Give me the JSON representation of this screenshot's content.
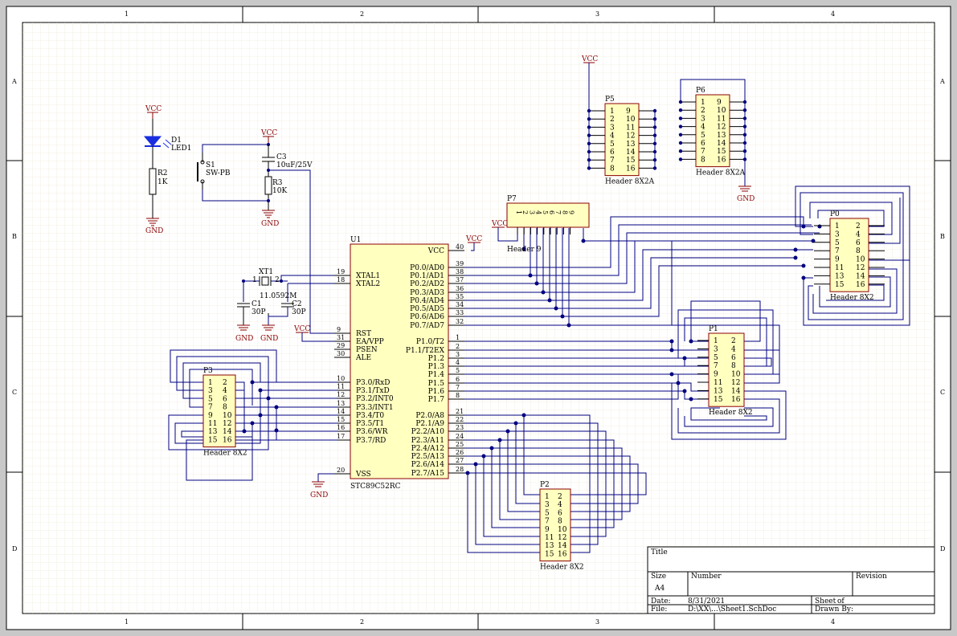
{
  "zone_cols": [
    "1",
    "2",
    "3",
    "4"
  ],
  "zone_rows": [
    "A",
    "B",
    "C",
    "D"
  ],
  "power": {
    "vcc": "VCC",
    "gnd": "GND"
  },
  "parts": {
    "d1": {
      "ref": "D1",
      "value": "LED1"
    },
    "r2": {
      "ref": "R2",
      "value": "1K"
    },
    "s1": {
      "ref": "S1",
      "value": "SW-PB"
    },
    "c3": {
      "ref": "C3",
      "value": "10uF/25V"
    },
    "r3": {
      "ref": "R3",
      "value": "10K"
    },
    "xt1": {
      "ref": "XT1",
      "value": "11.0592M",
      "pin1": "1",
      "pin2": "2"
    },
    "c1": {
      "ref": "C1",
      "value": "30P"
    },
    "c2": {
      "ref": "C2",
      "value": "30P"
    }
  },
  "u1": {
    "ref": "U1",
    "value": "STC89C52RC",
    "left_pins": [
      {
        "num": "19",
        "name": "XTAL1"
      },
      {
        "num": "18",
        "name": "XTAL2"
      },
      {
        "num": "9",
        "name": "RST"
      },
      {
        "num": "31",
        "name": "EA/VPP"
      },
      {
        "num": "29",
        "name": "PSEN"
      },
      {
        "num": "30",
        "name": "ALE"
      },
      {
        "num": "10",
        "name": "P3.0/RxD"
      },
      {
        "num": "11",
        "name": "P3.1/TxD"
      },
      {
        "num": "12",
        "name": "P3.2/INT0"
      },
      {
        "num": "13",
        "name": "P3.3/INT1"
      },
      {
        "num": "14",
        "name": "P3.4/T0"
      },
      {
        "num": "15",
        "name": "P3.5/T1"
      },
      {
        "num": "16",
        "name": "P3.6/WR"
      },
      {
        "num": "17",
        "name": "P3.7/RD"
      },
      {
        "num": "20",
        "name": "VSS"
      }
    ],
    "right_pins": [
      {
        "num": "40",
        "name": "VCC"
      },
      {
        "num": "39",
        "name": "P0.0/AD0"
      },
      {
        "num": "38",
        "name": "P0.1/AD1"
      },
      {
        "num": "37",
        "name": "P0.2/AD2"
      },
      {
        "num": "36",
        "name": "P0.3/AD3"
      },
      {
        "num": "35",
        "name": "P0.4/AD4"
      },
      {
        "num": "34",
        "name": "P0.5/AD5"
      },
      {
        "num": "33",
        "name": "P0.6/AD6"
      },
      {
        "num": "32",
        "name": "P0.7/AD7"
      },
      {
        "num": "1",
        "name": "P1.0/T2"
      },
      {
        "num": "2",
        "name": "P1.1/T2EX"
      },
      {
        "num": "3",
        "name": "P1.2"
      },
      {
        "num": "4",
        "name": "P1.3"
      },
      {
        "num": "5",
        "name": "P1.4"
      },
      {
        "num": "6",
        "name": "P1.5"
      },
      {
        "num": "7",
        "name": "P1.6"
      },
      {
        "num": "8",
        "name": "P1.7"
      },
      {
        "num": "21",
        "name": "P2.0/A8"
      },
      {
        "num": "22",
        "name": "P2.1/A9"
      },
      {
        "num": "23",
        "name": "P2.2/A10"
      },
      {
        "num": "24",
        "name": "P2.3/A11"
      },
      {
        "num": "25",
        "name": "P2.4/A12"
      },
      {
        "num": "26",
        "name": "P2.5/A13"
      },
      {
        "num": "27",
        "name": "P2.6/A14"
      },
      {
        "num": "28",
        "name": "P2.7/A15"
      }
    ]
  },
  "headers": [
    {
      "id": "p5",
      "ref": "P5",
      "value": "Header 8X2A",
      "left": [
        "1",
        "2",
        "3",
        "4",
        "5",
        "6",
        "7",
        "8"
      ],
      "right": [
        "9",
        "10",
        "11",
        "12",
        "13",
        "14",
        "15",
        "16"
      ]
    },
    {
      "id": "p6",
      "ref": "P6",
      "value": "Header 8X2A",
      "left": [
        "1",
        "2",
        "3",
        "4",
        "5",
        "6",
        "7",
        "8"
      ],
      "right": [
        "9",
        "10",
        "11",
        "12",
        "13",
        "14",
        "15",
        "16"
      ]
    },
    {
      "id": "p0",
      "ref": "P0",
      "value": "Header 8X2",
      "left": [
        "1",
        "3",
        "5",
        "7",
        "9",
        "11",
        "13",
        "15"
      ],
      "right": [
        "2",
        "4",
        "6",
        "8",
        "10",
        "12",
        "14",
        "16"
      ]
    },
    {
      "id": "p1",
      "ref": "P1",
      "value": "Header 8X2",
      "left": [
        "1",
        "3",
        "5",
        "7",
        "9",
        "11",
        "13",
        "15"
      ],
      "right": [
        "2",
        "4",
        "6",
        "8",
        "10",
        "12",
        "14",
        "16"
      ]
    },
    {
      "id": "p2",
      "ref": "P2",
      "value": "Header 8X2",
      "left": [
        "1",
        "3",
        "5",
        "7",
        "9",
        "11",
        "13",
        "15"
      ],
      "right": [
        "2",
        "4",
        "6",
        "8",
        "10",
        "12",
        "14",
        "16"
      ]
    },
    {
      "id": "p3",
      "ref": "P3",
      "value": "Header 8X2",
      "left": [
        "1",
        "3",
        "5",
        "7",
        "9",
        "11",
        "13",
        "15"
      ],
      "right": [
        "2",
        "4",
        "6",
        "8",
        "10",
        "12",
        "14",
        "16"
      ]
    }
  ],
  "p7": {
    "ref": "P7",
    "value": "Header 9",
    "pins": [
      "1",
      "2",
      "3",
      "4",
      "5",
      "6",
      "7",
      "8",
      "9"
    ]
  },
  "title_block": {
    "title_label": "Title",
    "size_label": "Size",
    "size_value": "A4",
    "number_label": "Number",
    "revision_label": "Revision",
    "date_label": "Date:",
    "date_value": "8/31/2021",
    "sheet_label": "Sheet",
    "sheet_of": "of",
    "file_label": "File:",
    "file_value": "D:\\XX\\...\\Sheet1.SchDoc",
    "drawn_label": "Drawn By:"
  }
}
